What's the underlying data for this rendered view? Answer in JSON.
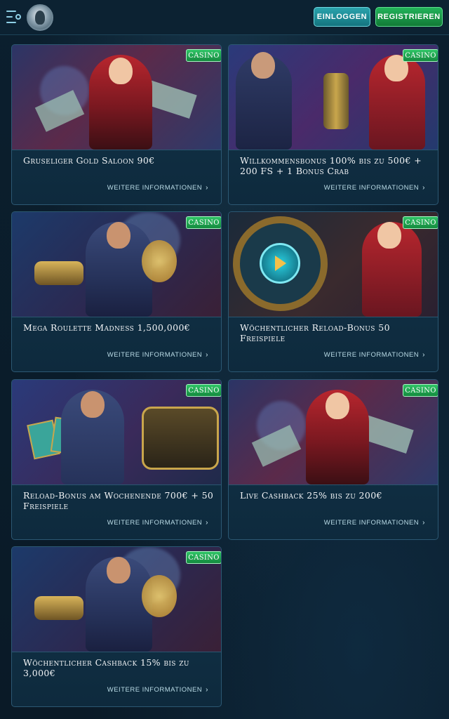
{
  "header": {
    "login_label": "EINLOGGEN",
    "register_label": "REGISTRIEREN"
  },
  "promotions": [
    {
      "badge": "CASINO",
      "title": "Gruseliger Gold Saloon 90€",
      "more": "WEITERE INFORMATIONEN"
    },
    {
      "badge": "CASINO",
      "title": "Willkommensbonus 100% bis zu 500€ + 200 FS + 1 Bonus Crab",
      "more": "WEITERE INFORMATIONEN"
    },
    {
      "badge": "CASINO",
      "title": "Mega Roulette Madness 1,500,000€",
      "more": "WEITERE INFORMATIONEN"
    },
    {
      "badge": "CASINO",
      "title": "Wöchentlicher Reload-Bonus 50 Freispiele",
      "more": "WEITERE INFORMATIONEN"
    },
    {
      "badge": "CASINO",
      "title": "Reload-Bonus am Wochenende 700€ + 50 Freispiele",
      "more": "WEITERE INFORMATIONEN"
    },
    {
      "badge": "CASINO",
      "title": "Live Cashback 25% bis zu 200€",
      "more": "WEITERE INFORMATIONEN"
    },
    {
      "badge": "CASINO",
      "title": "Wöchentlicher Cashback 15% bis zu 3,000€",
      "more": "WEITERE INFORMATIONEN"
    }
  ],
  "colors": {
    "badge_green": "#2fc466",
    "login_teal": "#2aa3ad",
    "register_green": "#22b35a",
    "card_border": "#2c5873"
  },
  "icons": {
    "menu": "menu-search-icon",
    "logo": "hooded-figure-logo",
    "chevron": "chevron-right-icon"
  }
}
